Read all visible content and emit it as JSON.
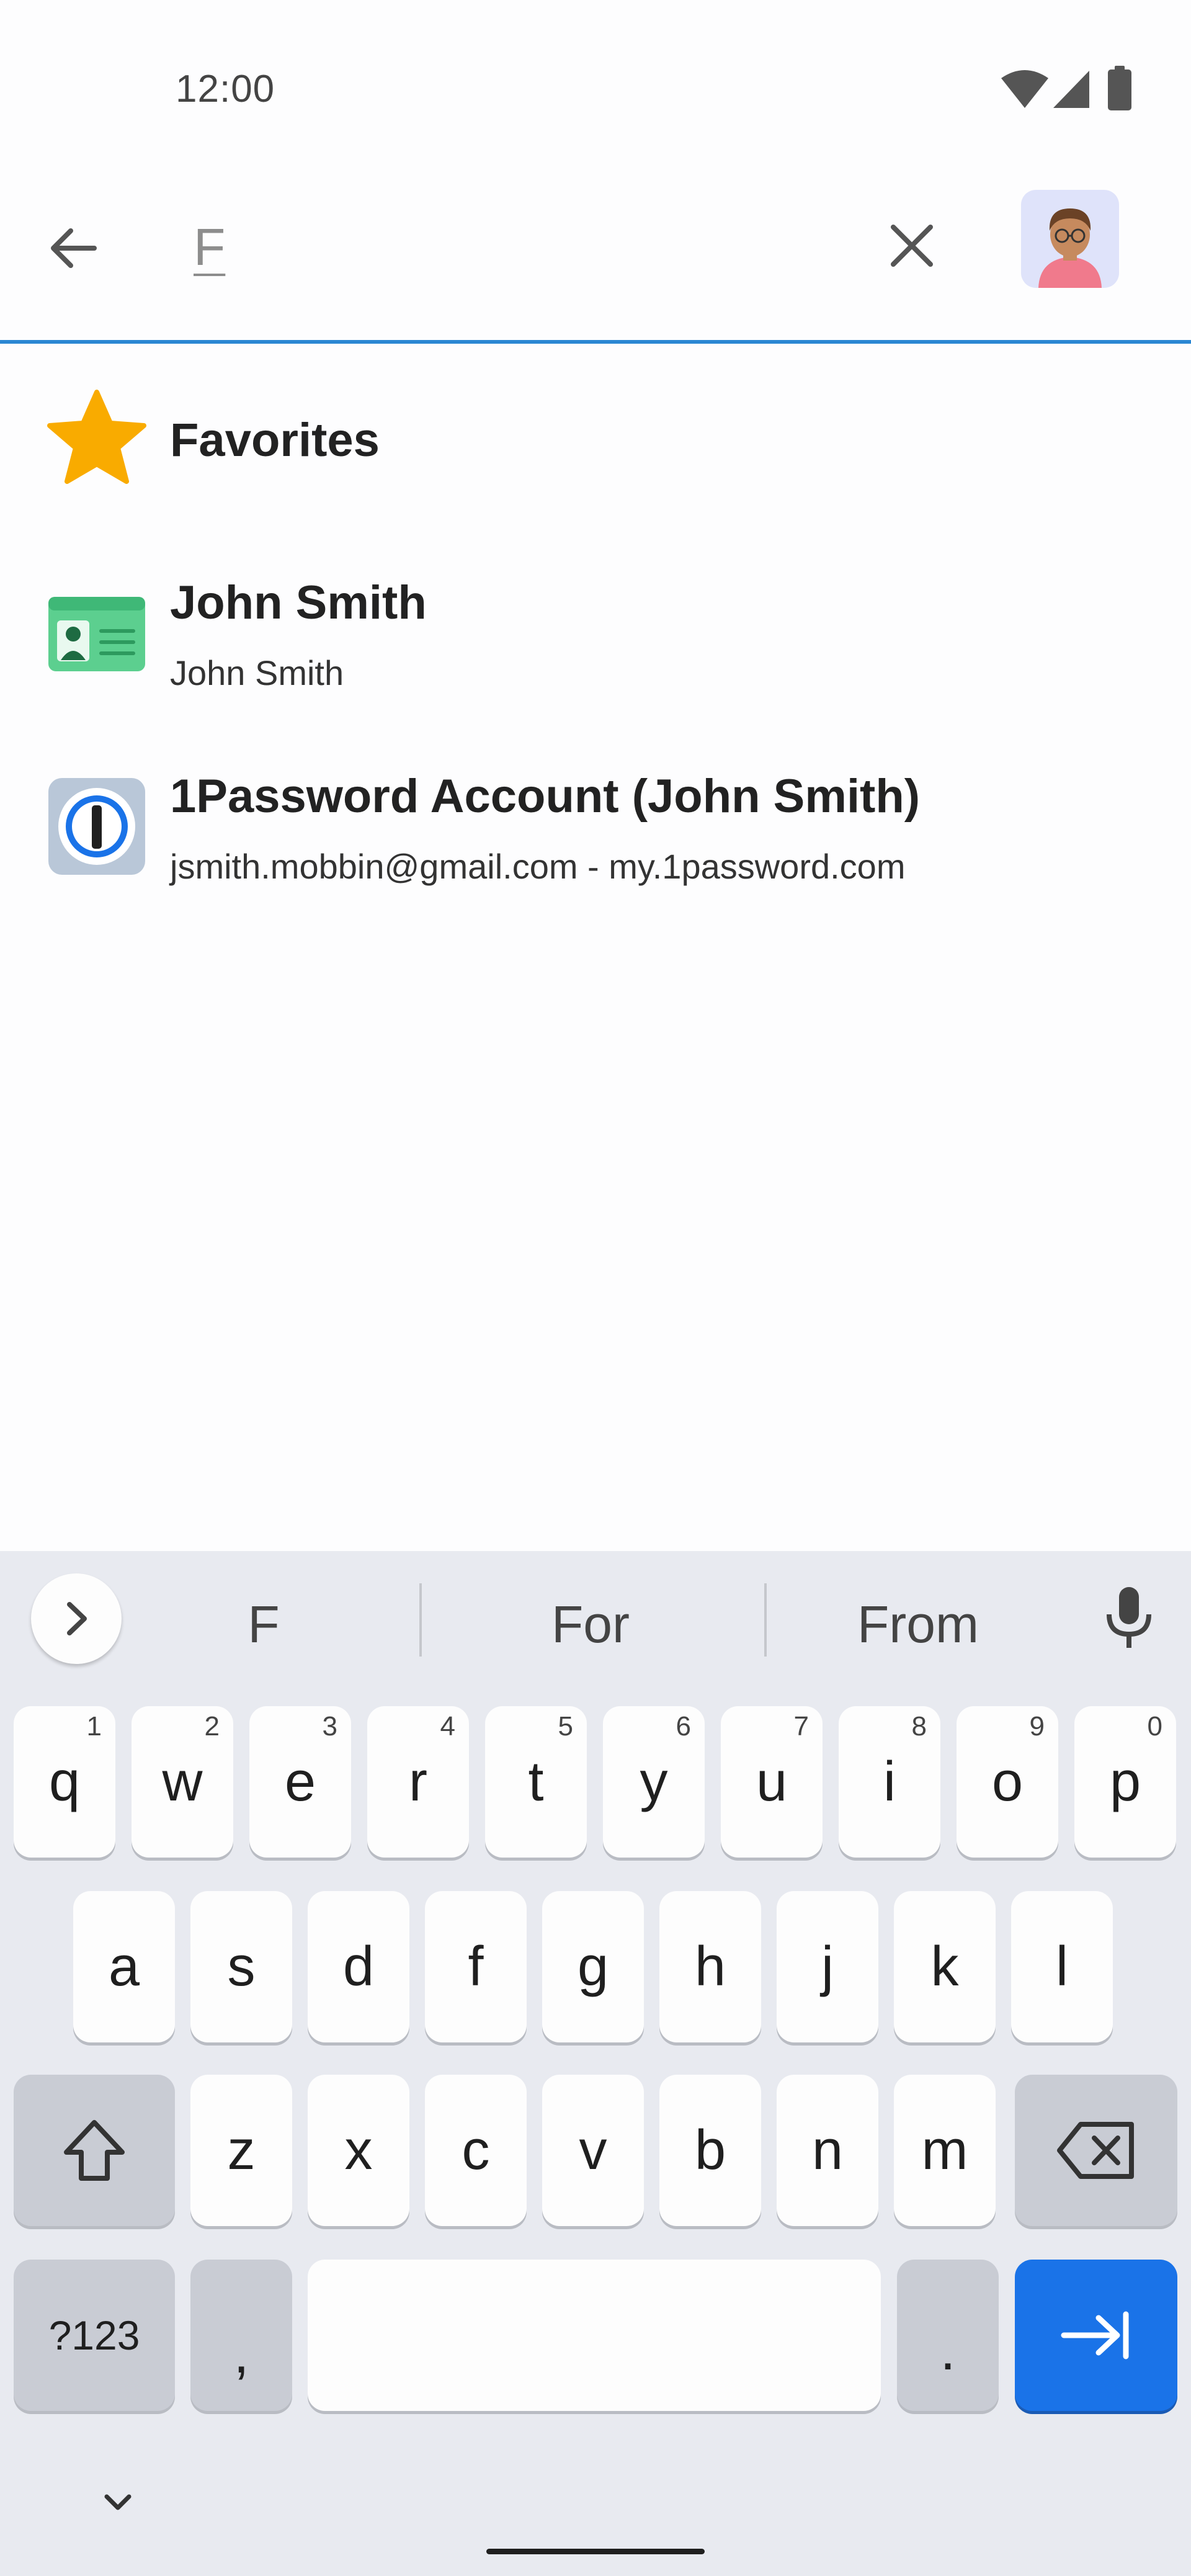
{
  "status_bar": {
    "time": "12:00"
  },
  "search": {
    "query": "F"
  },
  "results": [
    {
      "title": "Favorites",
      "subtitle": "",
      "icon": "star-icon"
    },
    {
      "title": "John Smith",
      "subtitle": "John Smith",
      "icon": "identity-card-icon"
    },
    {
      "title": "1Password Account (John Smith)",
      "subtitle": "jsmith.mobbin@gmail.com - my.1password.com",
      "icon": "onepassword-icon"
    }
  ],
  "keyboard": {
    "suggestions": [
      "F",
      "For",
      "From"
    ],
    "row1": [
      {
        "key": "q",
        "hint": "1"
      },
      {
        "key": "w",
        "hint": "2"
      },
      {
        "key": "e",
        "hint": "3"
      },
      {
        "key": "r",
        "hint": "4"
      },
      {
        "key": "t",
        "hint": "5"
      },
      {
        "key": "y",
        "hint": "6"
      },
      {
        "key": "u",
        "hint": "7"
      },
      {
        "key": "i",
        "hint": "8"
      },
      {
        "key": "o",
        "hint": "9"
      },
      {
        "key": "p",
        "hint": "0"
      }
    ],
    "row2": [
      "a",
      "s",
      "d",
      "f",
      "g",
      "h",
      "j",
      "k",
      "l"
    ],
    "row3": [
      "z",
      "x",
      "c",
      "v",
      "b",
      "n",
      "m"
    ],
    "symbols_label": "?123",
    "comma_label": ",",
    "period_label": "."
  },
  "colors": {
    "accent": "#1a73e8",
    "divider": "#2b87d3",
    "star": "#f9ab00",
    "card": "#5ccf8f"
  }
}
